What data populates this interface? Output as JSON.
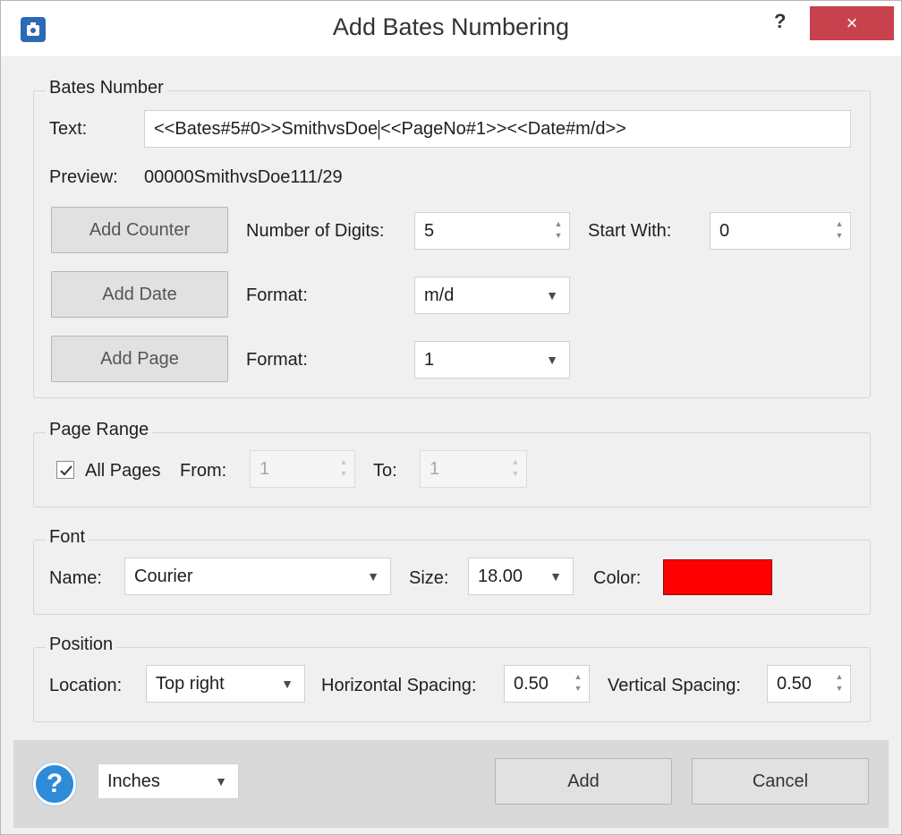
{
  "window": {
    "title": "Add Bates Numbering",
    "help_label": "?",
    "close_label": "×"
  },
  "bates": {
    "group_title": "Bates Number",
    "text_label": "Text:",
    "text_value_before_caret": "<<Bates#5#0>>SmithvsDoe",
    "text_value_after_caret": "<<PageNo#1>><<Date#m/d>>",
    "preview_label": "Preview:",
    "preview_value": "00000SmithvsDoe111/29",
    "add_counter_label": "Add Counter",
    "digits_label": "Number of Digits:",
    "digits_value": "5",
    "start_with_label": "Start With:",
    "start_with_value": "0",
    "add_date_label": "Add Date",
    "date_format_label": "Format:",
    "date_format_value": "m/d",
    "add_page_label": "Add Page",
    "page_format_label": "Format:",
    "page_format_value": "1"
  },
  "page_range": {
    "group_title": "Page Range",
    "all_pages_label": "All Pages",
    "all_pages_checked": true,
    "from_label": "From:",
    "from_value": "1",
    "to_label": "To:",
    "to_value": "1"
  },
  "font": {
    "group_title": "Font",
    "name_label": "Name:",
    "name_value": "Courier",
    "size_label": "Size:",
    "size_value": "18.00",
    "color_label": "Color:",
    "color_value": "#ff0000"
  },
  "position": {
    "group_title": "Position",
    "location_label": "Location:",
    "location_value": "Top right",
    "h_spacing_label": "Horizontal Spacing:",
    "h_spacing_value": "0.50",
    "v_spacing_label": "Vertical Spacing:",
    "v_spacing_value": "0.50"
  },
  "footer": {
    "help_icon_label": "?",
    "units_value": "Inches",
    "add_label": "Add",
    "cancel_label": "Cancel"
  },
  "icons": {
    "dropdown_arrow": "▼",
    "spin_up": "▲",
    "spin_down": "▼"
  }
}
